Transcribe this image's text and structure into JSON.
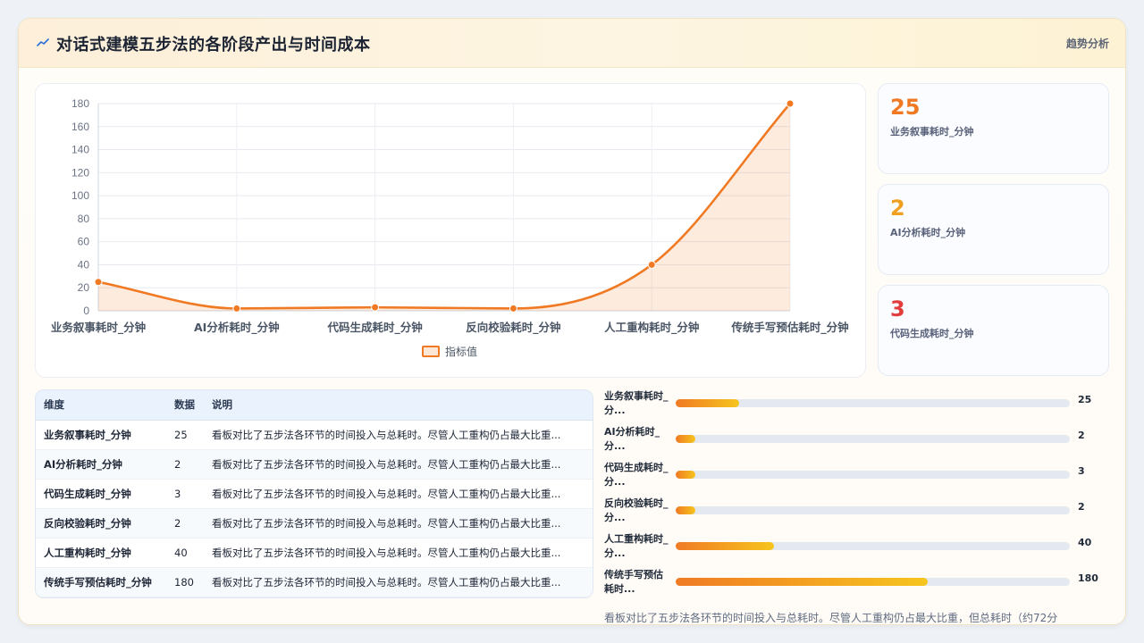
{
  "header": {
    "icon": "trend-line-icon",
    "title": "对话式建模五步法的各阶段产出与时间成本",
    "tag": "趋势分析"
  },
  "colors": {
    "accent": "#f07a24",
    "kpi_colors": [
      "#f07a24",
      "#f0a020",
      "#e23c3c"
    ]
  },
  "chart_data": {
    "type": "area",
    "categories": [
      "业务叙事耗时_分钟",
      "AI分析耗时_分钟",
      "代码生成耗时_分钟",
      "反向校验耗时_分钟",
      "人工重构耗时_分钟",
      "传统手写预估耗时_分钟"
    ],
    "series": [
      {
        "name": "指标值",
        "values": [
          25,
          2,
          3,
          2,
          40,
          180
        ]
      }
    ],
    "ylim": [
      0,
      180
    ],
    "yticks": [
      0,
      20,
      40,
      60,
      80,
      100,
      120,
      140,
      160,
      180
    ],
    "grid": true,
    "legend": "bottom",
    "smooth": true
  },
  "kpis": [
    {
      "value": "25",
      "label": "业务叙事耗时_分钟"
    },
    {
      "value": "2",
      "label": "AI分析耗时_分钟"
    },
    {
      "value": "3",
      "label": "代码生成耗时_分钟"
    }
  ],
  "table": {
    "headers": [
      "维度",
      "数据",
      "说明"
    ],
    "rows": [
      [
        "业务叙事耗时_分钟",
        "25",
        "看板对比了五步法各环节的时间投入与总耗时。尽管人工重构仍占最大比重..."
      ],
      [
        "AI分析耗时_分钟",
        "2",
        "看板对比了五步法各环节的时间投入与总耗时。尽管人工重构仍占最大比重..."
      ],
      [
        "代码生成耗时_分钟",
        "3",
        "看板对比了五步法各环节的时间投入与总耗时。尽管人工重构仍占最大比重..."
      ],
      [
        "反向校验耗时_分钟",
        "2",
        "看板对比了五步法各环节的时间投入与总耗时。尽管人工重构仍占最大比重..."
      ],
      [
        "人工重构耗时_分钟",
        "40",
        "看板对比了五步法各环节的时间投入与总耗时。尽管人工重构仍占最大比重..."
      ],
      [
        "传统手写预估耗时_分钟",
        "180",
        "看板对比了五步法各环节的时间投入与总耗时。尽管人工重构仍占最大比重..."
      ]
    ]
  },
  "bars": [
    {
      "label": "业务叙事耗时_分...",
      "value": "25",
      "fill": 0.16
    },
    {
      "label": "AI分析耗时_分...",
      "value": "2",
      "fill": 0.05
    },
    {
      "label": "代码生成耗时_分...",
      "value": "3",
      "fill": 0.05
    },
    {
      "label": "反向校验耗时_分...",
      "value": "2",
      "fill": 0.05
    },
    {
      "label": "人工重构耗时_分...",
      "value": "40",
      "fill": 0.25
    },
    {
      "label": "传统手写预估耗时...",
      "value": "180",
      "fill": 0.64
    }
  ],
  "summary": "看板对比了五步法各环节的时间投入与总耗时。尽管人工重构仍占最大比重，但总耗时（约72分"
}
